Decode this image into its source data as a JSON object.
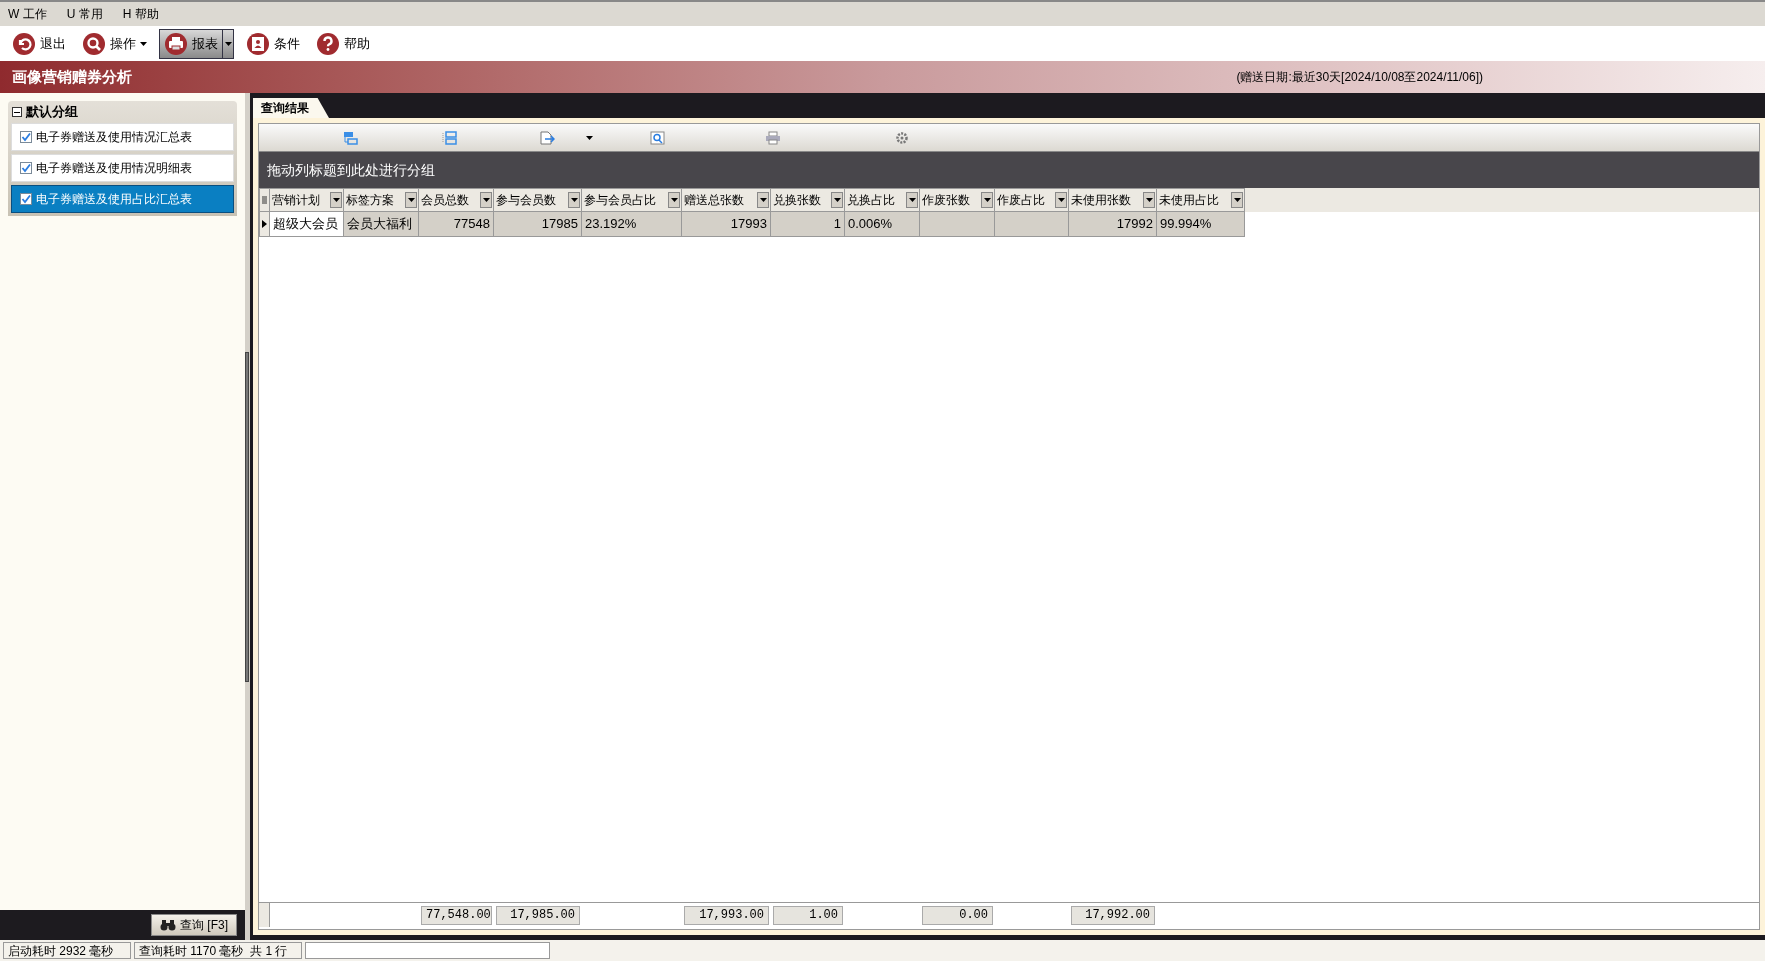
{
  "menu": [
    "W 工作",
    "U 常用",
    "H 帮助"
  ],
  "toolbar": [
    {
      "label": "退出",
      "kind": "plain",
      "selected": false
    },
    {
      "label": "操作",
      "kind": "dropdown",
      "selected": false
    },
    {
      "label": "报表",
      "kind": "split",
      "selected": true
    },
    {
      "label": "条件",
      "kind": "plain",
      "selected": false
    },
    {
      "label": "帮助",
      "kind": "plain",
      "selected": false
    }
  ],
  "title": "画像营销赠券分析",
  "date_range": "(赠送日期:最近30天[2024/10/08至2024/11/06])",
  "sidebar": {
    "group": "默认分组",
    "expanded": true,
    "items": [
      {
        "label": "电子券赠送及使用情况汇总表",
        "checked": true,
        "selected": false
      },
      {
        "label": "电子券赠送及使用情况明细表",
        "checked": true,
        "selected": false
      },
      {
        "label": "电子券赠送及使用占比汇总表",
        "checked": true,
        "selected": true
      }
    ],
    "query_button": "查询 [F3]"
  },
  "tab": "查询结果",
  "group_hint": "拖动列标题到此处进行分组",
  "columns": [
    {
      "label": "营销计划",
      "kind": "text"
    },
    {
      "label": "标签方案",
      "kind": "text"
    },
    {
      "label": "会员总数",
      "kind": "number",
      "total": "77,548.00"
    },
    {
      "label": "参与会员数",
      "kind": "number",
      "total": "17,985.00"
    },
    {
      "label": "参与会员占比",
      "kind": "percent"
    },
    {
      "label": "赠送总张数",
      "kind": "number",
      "total": "17,993.00"
    },
    {
      "label": "兑换张数",
      "kind": "number",
      "total": "1.00"
    },
    {
      "label": "兑换占比",
      "kind": "percent"
    },
    {
      "label": "作废张数",
      "kind": "number",
      "total": "0.00"
    },
    {
      "label": "作废占比",
      "kind": "percent"
    },
    {
      "label": "未使用张数",
      "kind": "number",
      "total": "17,992.00"
    },
    {
      "label": "未使用占比",
      "kind": "percent"
    }
  ],
  "rows": [
    {
      "selected": true,
      "cells": [
        "超级大会员",
        "会员大福利",
        "77548",
        "17985",
        "23.192%",
        "17993",
        "1",
        "0.006%",
        null,
        null,
        "17992",
        "99.994%"
      ]
    }
  ],
  "status_bar": [
    "启动耗时 2932 毫秒",
    "查询耗时 1170 毫秒  共 1 行"
  ]
}
